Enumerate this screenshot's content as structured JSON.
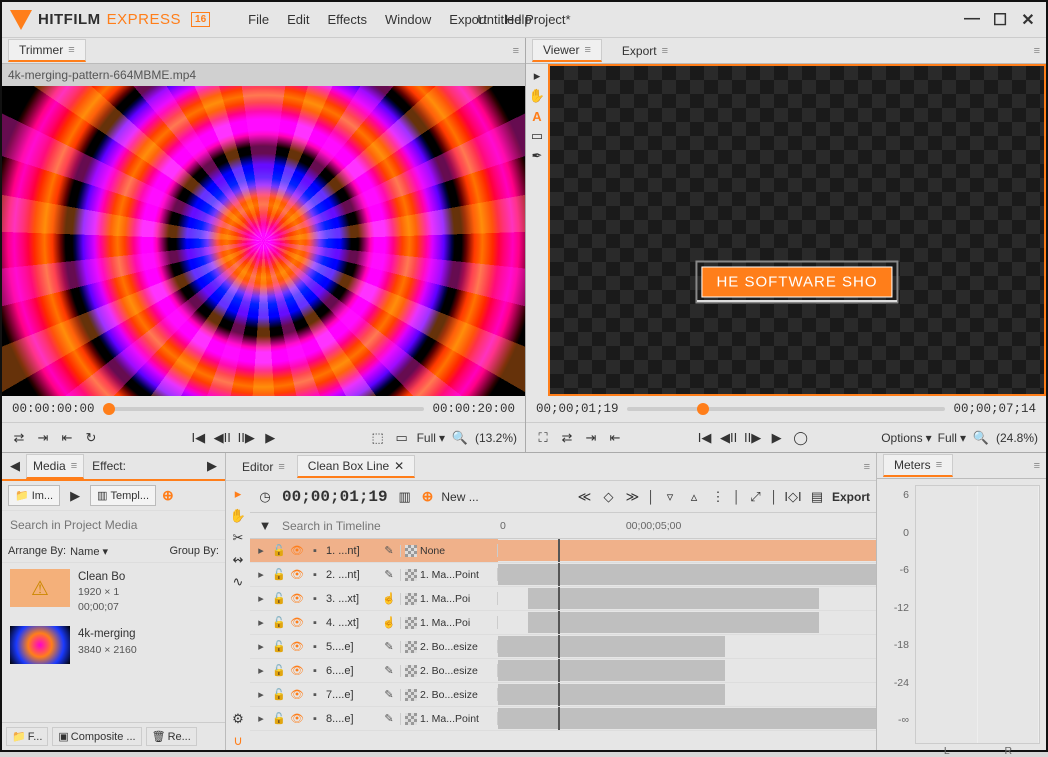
{
  "app": {
    "brand": "HITFILM",
    "variant": "EXPRESS",
    "version": "16",
    "project_title": "Untitled Project*"
  },
  "menu": [
    "File",
    "Edit",
    "Effects",
    "Window",
    "Export",
    "Help"
  ],
  "trimmer": {
    "label": "Trimmer",
    "filename": "4k-merging-pattern-664MBME.mp4",
    "tc_start": "00:00:00:00",
    "tc_end": "00:00:20:00",
    "full": "Full",
    "zoom": "(13.2%)"
  },
  "viewer": {
    "label": "Viewer",
    "export_tab": "Export",
    "tc_start": "00;00;01;19",
    "tc_end": "00;00;07;14",
    "options": "Options",
    "full": "Full",
    "zoom": "(24.8%)",
    "overlay_text": "HE SOFTWARE SHO"
  },
  "media": {
    "tab_media": "Media",
    "tab_effects": "Effect:",
    "import": "Im...",
    "templates": "Templ...",
    "search_placeholder": "Search in Project Media",
    "arrange_label": "Arrange By:",
    "arrange_val": "Name",
    "group_label": "Group By:",
    "items": [
      {
        "name": "Clean Bo",
        "res": "1920 × 1",
        "tc": "00;00;07"
      },
      {
        "name": "4k-merging",
        "res": "3840 × 2160"
      }
    ],
    "foot_folder": "F...",
    "foot_comp": "Composite ...",
    "foot_remove": "Re..."
  },
  "editor": {
    "tab_editor": "Editor",
    "tab_comp": "Clean Box Line",
    "tc": "00;00;01;19",
    "new": "New ...",
    "export": "Export",
    "search_placeholder": "Search in Timeline",
    "ruler": [
      "0",
      "00;00;05;00"
    ],
    "tracks": [
      {
        "n": "1. ...nt]",
        "fx": "None",
        "sel": true,
        "hand": false,
        "c0": 0,
        "c1": 100,
        "pk": true
      },
      {
        "n": "2. ...nt]",
        "fx": "1. Ma...Point",
        "hand": false,
        "c0": 0,
        "c1": 100
      },
      {
        "n": "3. ...xt]",
        "fx": "1. Ma...Poi",
        "hand": true,
        "c0": 8,
        "c1": 85
      },
      {
        "n": "4. ...xt]",
        "fx": "1. Ma...Poi",
        "hand": true,
        "c0": 8,
        "c1": 85
      },
      {
        "n": "5....e]",
        "fx": "2. Bo...esize",
        "hand": false,
        "c0": 0,
        "c1": 60
      },
      {
        "n": "6....e]",
        "fx": "2. Bo...esize",
        "hand": false,
        "c0": 0,
        "c1": 60
      },
      {
        "n": "7....e]",
        "fx": "2. Bo...esize",
        "hand": false,
        "c0": 0,
        "c1": 60
      },
      {
        "n": "8....e]",
        "fx": "1. Ma...Point",
        "hand": false,
        "c0": 0,
        "c1": 100
      }
    ]
  },
  "meters": {
    "label": "Meters",
    "scale": [
      "6",
      "0",
      "-6",
      "-12",
      "-18",
      "-24",
      "-∞"
    ],
    "channels": [
      "L",
      "R"
    ]
  }
}
